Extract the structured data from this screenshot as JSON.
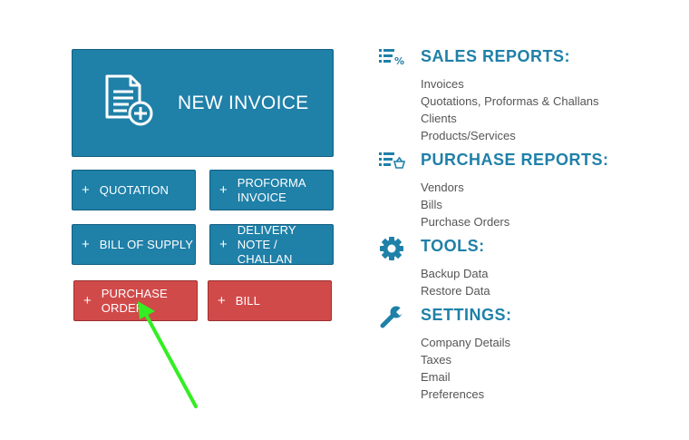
{
  "main_buttons": {
    "new_invoice": "NEW INVOICE",
    "quotation": "QUOTATION",
    "proforma": "PROFORMA INVOICE",
    "bill_of_supply": "BILL OF SUPPLY",
    "delivery": "DELIVERY NOTE / CHALLAN",
    "purchase_order": "PURCHASE ORDER",
    "bill": "BILL",
    "plus": "+"
  },
  "sections": {
    "sales": {
      "title": "SALES REPORTS:",
      "icon": "list-percent-icon",
      "items": [
        "Invoices",
        "Quotations, Proformas & Challans",
        "Clients",
        "Products/Services"
      ]
    },
    "purchase": {
      "title": "PURCHASE REPORTS:",
      "icon": "list-basket-icon",
      "items": [
        "Vendors",
        "Bills",
        "Purchase Orders"
      ]
    },
    "tools": {
      "title": "TOOLS:",
      "icon": "gear-icon",
      "items": [
        "Backup Data",
        "Restore Data"
      ]
    },
    "settings": {
      "title": "SETTINGS:",
      "icon": "wrench-icon",
      "items": [
        "Company Details",
        "Taxes",
        "Email",
        "Preferences"
      ]
    }
  },
  "colors": {
    "primary_blue": "#1f80a8",
    "purchase_red": "#d14a4a",
    "annotation_arrow": "#33ee22"
  }
}
